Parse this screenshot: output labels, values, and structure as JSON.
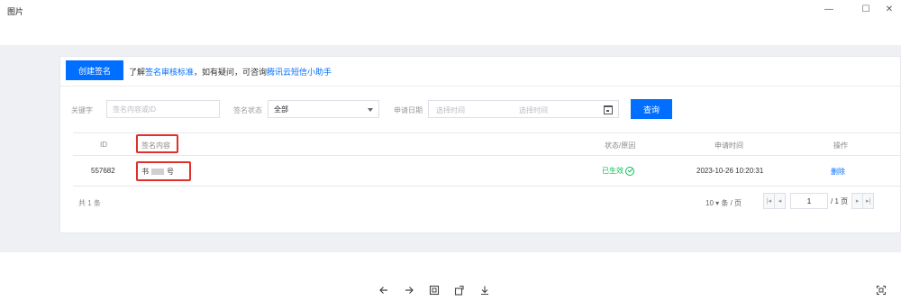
{
  "window": {
    "title": "图片"
  },
  "toolbar": {
    "create_label": "创建签名"
  },
  "notice": {
    "prefix": "了解",
    "link1": "签名审核标准",
    "middle": "，如有疑问，可咨询",
    "link2": "腾讯云短信小助手"
  },
  "filters": {
    "keyword_label": "关键字",
    "keyword_placeholder": "签名内容或ID",
    "status_label": "签名状态",
    "status_value": "全部",
    "date_label": "申请日期",
    "start_placeholder": "选择时间",
    "end_placeholder": "选择时间",
    "query_label": "查询"
  },
  "table": {
    "headers": {
      "id": "ID",
      "content": "签名内容",
      "status": "状态/原因",
      "time": "申请时间",
      "action": "操作"
    },
    "rows": [
      {
        "id": "557682",
        "content_prefix": "书",
        "content_suffix": "号",
        "status": "已生效",
        "time": "2023-10-26 10:20:31",
        "action": "删除"
      }
    ]
  },
  "footer": {
    "total": "共 1 条",
    "page_size": "10 ▾ 条 / 页",
    "page_value": "1",
    "page_total": "/ 1 页"
  },
  "colors": {
    "primary": "#006eff",
    "success": "#0abf5b",
    "highlight": "#e0302a"
  }
}
